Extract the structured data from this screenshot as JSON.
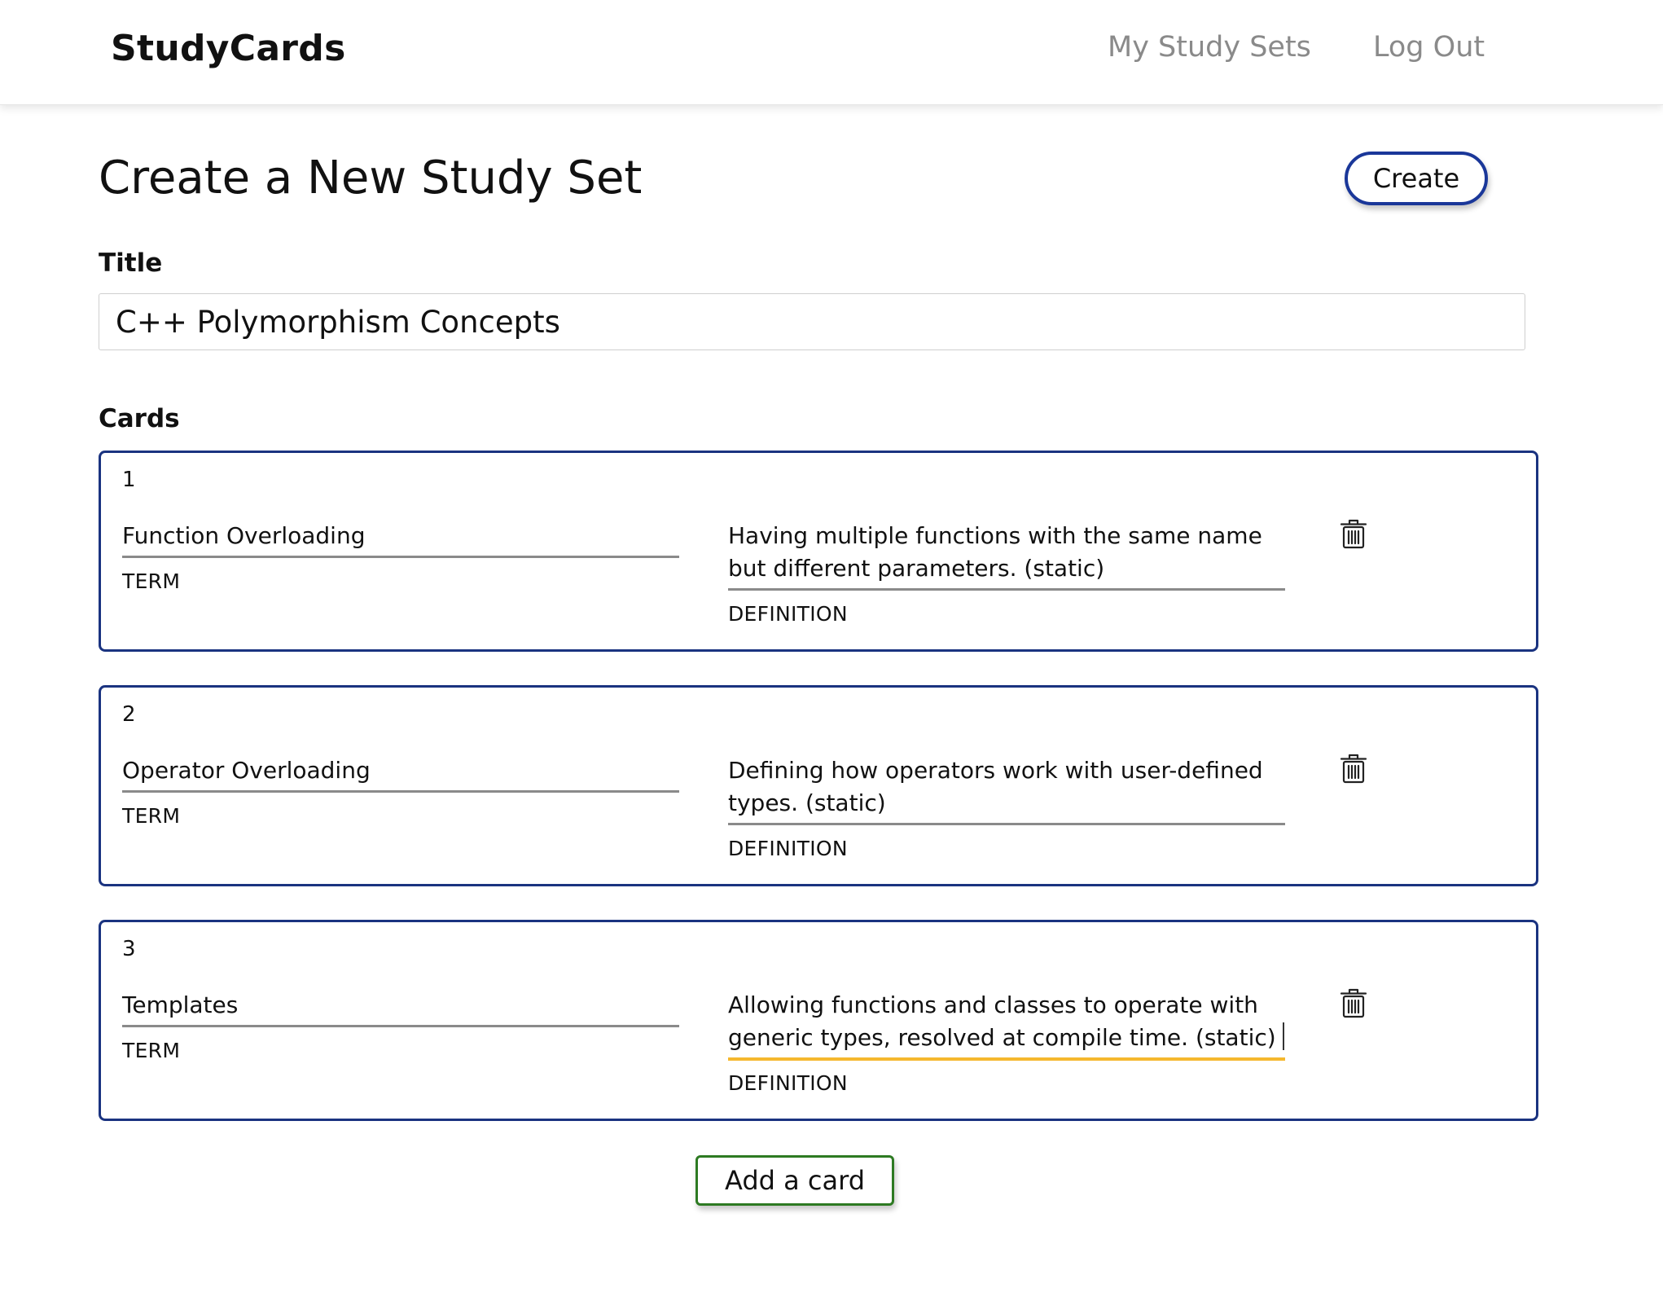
{
  "header": {
    "brand": "StudyCards",
    "nav": {
      "my_study_sets": "My Study Sets",
      "log_out": "Log Out"
    }
  },
  "page": {
    "title": "Create a New Study Set",
    "create_button": "Create",
    "title_label": "Title",
    "title_value": "C++ Polymorphism Concepts",
    "cards_label": "Cards",
    "add_card_button": "Add a card"
  },
  "cards": [
    {
      "number": "1",
      "term": "Function Overloading",
      "term_label": "TERM",
      "definition": "Having multiple functions with the same name but different parameters. (static)",
      "definition_label": "DEFINITION"
    },
    {
      "number": "2",
      "term": "Operator Overloading",
      "term_label": "TERM",
      "definition": "Defining how operators work with user-defined types. (static)",
      "definition_label": "DEFINITION"
    },
    {
      "number": "3",
      "term": "Templates",
      "term_label": "TERM",
      "definition": "Allowing functions and classes to operate with generic types, resolved at compile time. (static)",
      "definition_label": "DEFINITION",
      "focused": true
    }
  ],
  "icons": {
    "delete": "trash-icon"
  },
  "colors": {
    "card_border": "#1a3380",
    "create_border": "#1a3799",
    "add_card_border": "#2d7a22",
    "focus_underline": "#f5b82e",
    "nav_text": "#8a8a8a"
  }
}
